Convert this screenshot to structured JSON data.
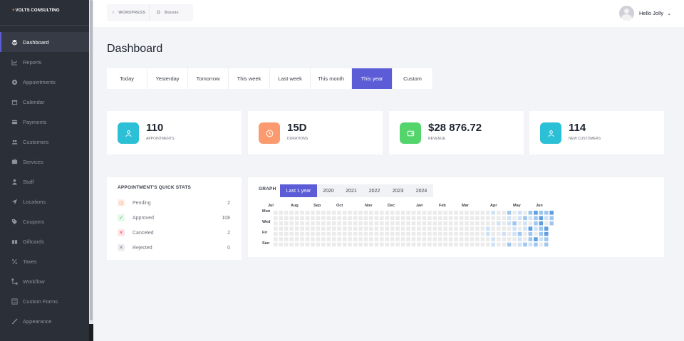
{
  "brand": {
    "plus": "+",
    "name": "VOLTS CONSULTING"
  },
  "sidebar": {
    "items": [
      {
        "label": "Dashboard",
        "icon": "dashboard-icon",
        "active": true
      },
      {
        "label": "Reports",
        "icon": "chart-icon"
      },
      {
        "label": "Appointments",
        "icon": "appointments-icon"
      },
      {
        "label": "Calendar",
        "icon": "calendar-icon"
      },
      {
        "label": "Payments",
        "icon": "credit-card-icon"
      },
      {
        "label": "Customers",
        "icon": "users-icon"
      },
      {
        "label": "Services",
        "icon": "services-icon"
      },
      {
        "label": "Staff",
        "icon": "staff-icon"
      },
      {
        "label": "Locations",
        "icon": "location-arrow-icon"
      },
      {
        "label": "Coupons",
        "icon": "tag-icon"
      },
      {
        "label": "Giftcards",
        "icon": "giftcard-icon"
      },
      {
        "label": "Taxes",
        "icon": "percent-icon"
      },
      {
        "label": "Workflow",
        "icon": "workflow-icon"
      },
      {
        "label": "Custom Forms",
        "icon": "custom-forms-icon"
      },
      {
        "label": "Appearance",
        "icon": "brush-icon"
      }
    ]
  },
  "topbar": {
    "crumbs": [
      {
        "label": "WORDPRESS",
        "icon": "chevron-left-icon"
      },
      {
        "label": "Booste",
        "icon": "bookneto-icon"
      }
    ],
    "user_name": "Hello Jolly"
  },
  "page_title": "Dashboard",
  "period_tabs": [
    {
      "label": "Today",
      "w": 57
    },
    {
      "label": "Yesterday",
      "w": 57
    },
    {
      "label": "Tomorrow",
      "w": 57
    },
    {
      "label": "This week",
      "w": 58
    },
    {
      "label": "Last week",
      "w": 57
    },
    {
      "label": "This month",
      "w": 58
    },
    {
      "label": "This year",
      "w": 57,
      "active": true
    },
    {
      "label": "Custom",
      "w": 57
    }
  ],
  "stats": [
    {
      "value": "110",
      "label": "APPOINTMENTS",
      "color": "#2bc0d6",
      "icon": "user-icon"
    },
    {
      "value": "15D",
      "label": "DURATIONS",
      "color": "#fb9a6e",
      "icon": "clock-icon"
    },
    {
      "value": "$28 876.72",
      "label": "REVENUE",
      "color": "#53d56c",
      "icon": "wallet-icon"
    },
    {
      "value": "114",
      "label": "NEW CUSTOMERS",
      "color": "#2bc0d6",
      "icon": "user-icon"
    }
  ],
  "quick_stats": {
    "title": "APPOINTMENT'S QUICK STATS",
    "rows": [
      {
        "label": "Pending",
        "value": "2",
        "icon": "clock-icon",
        "color": "#fb9a6e",
        "bg": "#ffeee6",
        "glyph": "◷"
      },
      {
        "label": "Approved",
        "value": "108",
        "icon": "check-icon",
        "color": "#3cc556",
        "bg": "#e6f8ea",
        "glyph": "✓"
      },
      {
        "label": "Canceled",
        "value": "2",
        "icon": "close-icon",
        "color": "#f2485a",
        "bg": "#fde6e8",
        "glyph": "✕"
      },
      {
        "label": "Rejected",
        "value": "0",
        "icon": "close-icon",
        "color": "#7a7f88",
        "bg": "#eceef1",
        "glyph": "✕"
      }
    ]
  },
  "graph": {
    "title": "GRAPH",
    "tabs": [
      {
        "label": "Last 1 year",
        "active": true
      },
      {
        "label": "2020"
      },
      {
        "label": "2021"
      },
      {
        "label": "2022"
      },
      {
        "label": "2023"
      },
      {
        "label": "2024"
      }
    ],
    "months": [
      "Jul",
      "Aug",
      "Sep",
      "Oct",
      "Nov",
      "Dec",
      "Jan",
      "Feb",
      "Mar",
      "Apr",
      "May",
      "Jun"
    ],
    "days": [
      "Mon",
      "Wed",
      "Fri",
      "Sun"
    ]
  },
  "colors": {
    "accent": "#5b5cd6",
    "heat_empty": "#ebebeb",
    "heat_levels": [
      "#cfe2f6",
      "#9fc7ee",
      "#5e9fe0"
    ]
  }
}
